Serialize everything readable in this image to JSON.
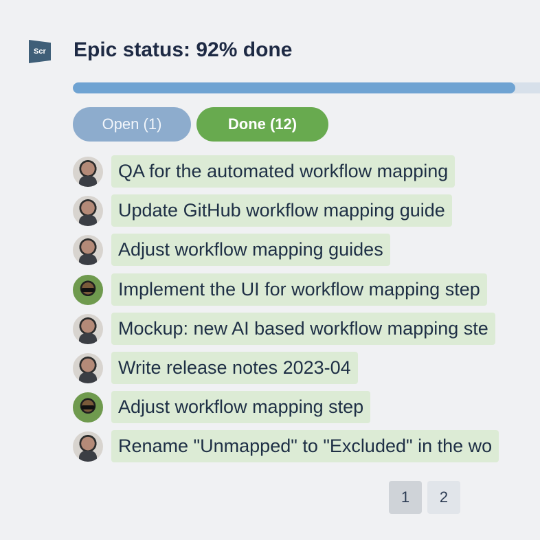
{
  "header": {
    "logo_text": "Scr",
    "title": "Epic status: 92% done",
    "progress_percent": 92
  },
  "filters": {
    "open_label": "Open (1)",
    "done_label": "Done (12)",
    "selected": "done"
  },
  "tasks": [
    {
      "title": "QA for the automated workflow mapping",
      "avatar": "person-avatar-1"
    },
    {
      "title": "Update GitHub workflow mapping guide",
      "avatar": "person-avatar-1"
    },
    {
      "title": "Adjust workflow mapping guides",
      "avatar": "person-avatar-1"
    },
    {
      "title": "Implement the UI for workflow mapping step",
      "avatar": "person-avatar-2"
    },
    {
      "title": "Mockup: new AI based workflow mapping ste",
      "avatar": "person-avatar-1"
    },
    {
      "title": "Write release notes 2023-04",
      "avatar": "person-avatar-1"
    },
    {
      "title": "Adjust workflow mapping step",
      "avatar": "person-avatar-2"
    },
    {
      "title": "Rename \"Unmapped\" to \"Excluded\" in the wo",
      "avatar": "person-avatar-1"
    }
  ],
  "pagination": {
    "pages": [
      "1",
      "2"
    ],
    "current": "1"
  },
  "colors": {
    "progress": "#6fa3d2",
    "done_filter": "#68aa4f",
    "open_filter": "#8daccd",
    "task_bg": "#dcebd5"
  }
}
